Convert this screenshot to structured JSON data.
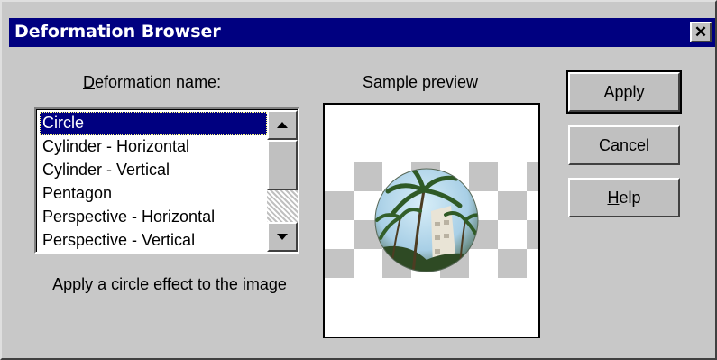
{
  "window": {
    "title": "Deformation Browser"
  },
  "list": {
    "label_accel": "D",
    "label_rest": "eformation name:",
    "items": [
      "Circle",
      "Cylinder - Horizontal",
      "Cylinder - Vertical",
      "Pentagon",
      "Perspective - Horizontal",
      "Perspective - Vertical"
    ],
    "selected": "Circle"
  },
  "preview": {
    "label": "Sample preview"
  },
  "description": "Apply a circle effect to the image",
  "buttons": {
    "apply": "Apply",
    "cancel": "Cancel",
    "help_accel": "H",
    "help_rest": "elp"
  },
  "icons": {
    "close": "close-icon",
    "scroll_up": "arrow-up-icon",
    "scroll_down": "arrow-down-icon"
  },
  "colors": {
    "titlebar": "#000080",
    "selection": "#000080",
    "dialog": "#c8c8c8"
  }
}
